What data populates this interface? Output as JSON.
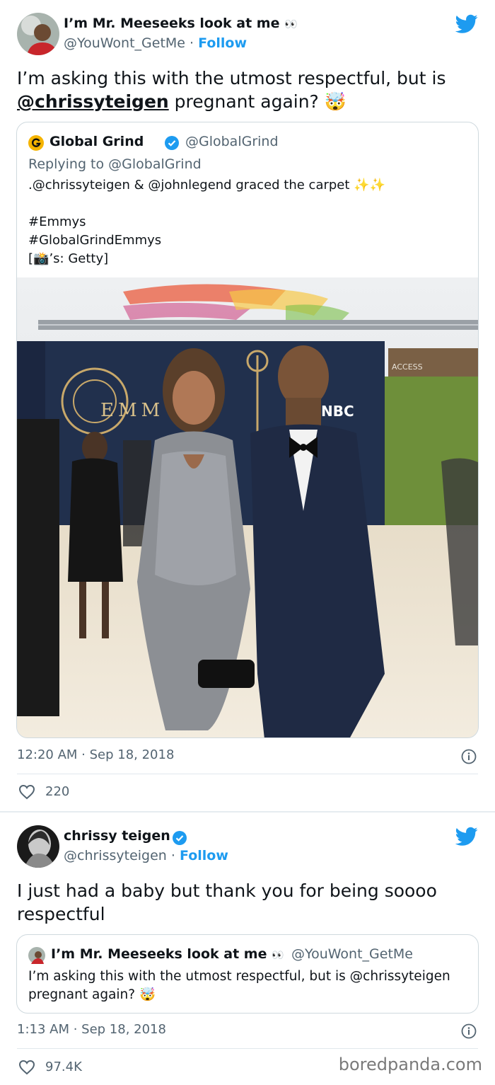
{
  "tweet1": {
    "display_name": "I’m Mr. Meeseeks look at me",
    "name_emoji": "👀",
    "handle": "@YouWont_GetMe",
    "separator": "·",
    "follow_label": "Follow",
    "text_line1": "I’m asking this with the utmost respectful, but is",
    "text_mention": "@chrissyteigen",
    "text_rest": " pregnant again? ",
    "text_emoji": "🤯",
    "quote": {
      "name": "Global Grind",
      "handle": "@GlobalGrind",
      "replying_to": "Replying to @GlobalGrind",
      "line1": ".@chrissyteigen & @johnlegend graced the carpet ✨✨",
      "line2": "#Emmys",
      "line3": "#GlobalGrindEmmys",
      "line4_prefix": "[",
      "line4_emoji": "📸",
      "line4_suffix": "’s: Getty]",
      "photo_sign1": "EMM",
      "photo_sign2": "NBC",
      "photo_sign3": "ACCESS"
    },
    "timestamp": "12:20 AM · Sep 18, 2018",
    "likes": "220"
  },
  "tweet2": {
    "display_name": "chrissy teigen",
    "handle": "@chrissyteigen",
    "separator": "·",
    "follow_label": "Follow",
    "text": "I just had a baby but thank you for being soooo respectful",
    "quote": {
      "name": "I’m Mr. Meeseeks look at me",
      "name_emoji": "👀",
      "handle": "@YouWont_GetMe",
      "line1": "I’m asking this with the utmost respectful, but is @chrissyteigen",
      "line2": " pregnant again? ",
      "line2_emoji": "🤯"
    },
    "timestamp": "1:13 AM · Sep 18, 2018",
    "likes": "97.4K"
  },
  "watermark": "boredpanda.com",
  "colors": {
    "accent": "#1d9bf0",
    "text": "#0f1419",
    "muted": "#536471",
    "border": "#cfd9de"
  }
}
